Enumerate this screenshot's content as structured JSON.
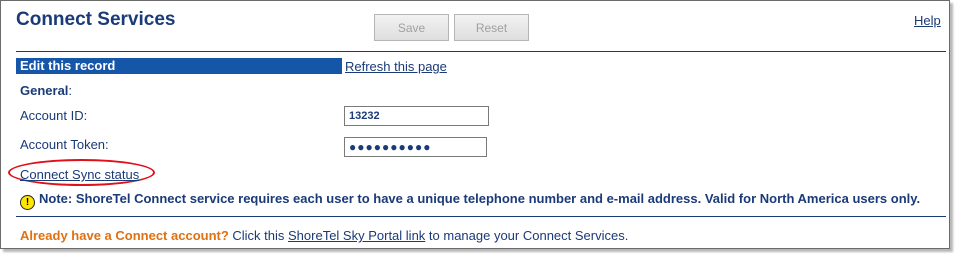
{
  "page": {
    "title": "Connect Services",
    "help_label": "Help"
  },
  "toolbar": {
    "save_label": "Save",
    "reset_label": "Reset"
  },
  "section": {
    "header": "Edit this record",
    "refresh_link": "Refresh this page"
  },
  "general": {
    "heading": "General",
    "heading_suffix": ":"
  },
  "fields": {
    "account_id_label": "Account ID:",
    "account_id_value": "13232",
    "account_token_label": "Account Token:",
    "account_token_value": "●●●●●●●●●●"
  },
  "sync_link": "Connect Sync status",
  "note": {
    "icon": "warning-icon",
    "text": "Note: ShoreTel Connect service requires each user to have a unique telephone number and e-mail address. Valid for North America users only."
  },
  "footer": {
    "prompt": "Already have a Connect account?",
    "text_before": " Click this ",
    "portal_link": "ShoreTel Sky Portal link",
    "text_after": " to manage your Connect Services."
  },
  "colors": {
    "header_bar": "#1556a8",
    "text": "#1a3a78",
    "highlight_oval": "#e0101a",
    "footer_prompt": "#e07010"
  }
}
